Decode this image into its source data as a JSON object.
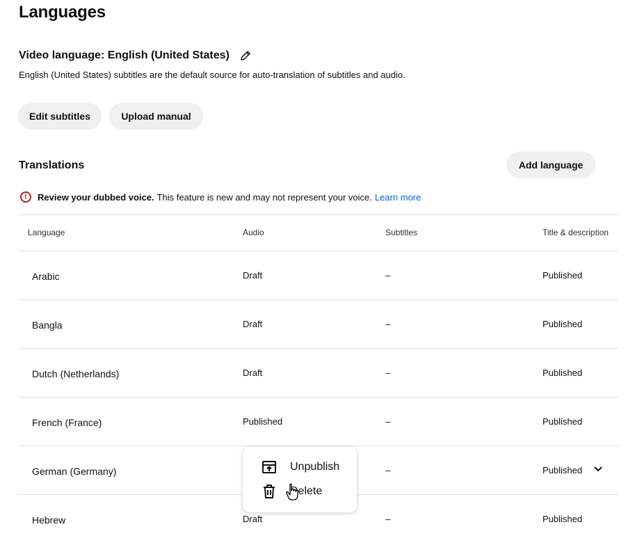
{
  "page": {
    "title": "Languages",
    "video_language_label": "Video language: English (United States)",
    "description": "English (United States) subtitles are the default source for auto-translation of subtitles and audio."
  },
  "buttons": {
    "edit_subtitles": "Edit subtitles",
    "upload_manual": "Upload manual",
    "add_language": "Add language"
  },
  "translations": {
    "heading": "Translations",
    "notice_bold": "Review your dubbed voice.",
    "notice_text": "This feature is new and may not represent your voice.",
    "notice_link": "Learn more"
  },
  "table": {
    "headers": {
      "language": "Language",
      "audio": "Audio",
      "subtitles": "Subtitles",
      "title_desc": "Title & description"
    },
    "rows": [
      {
        "language": "Arabic",
        "audio": "Draft",
        "subtitles": "–",
        "title_desc": "Published"
      },
      {
        "language": "Bangla",
        "audio": "Draft",
        "subtitles": "–",
        "title_desc": "Published"
      },
      {
        "language": "Dutch (Netherlands)",
        "audio": "Draft",
        "subtitles": "–",
        "title_desc": "Published"
      },
      {
        "language": "French (France)",
        "audio": "Published",
        "subtitles": "–",
        "title_desc": "Published"
      },
      {
        "language": "German (Germany)",
        "audio": "",
        "subtitles": "–",
        "title_desc": "Published"
      },
      {
        "language": "Hebrew",
        "audio": "Draft",
        "subtitles": "–",
        "title_desc": "Published"
      }
    ]
  },
  "context_menu": {
    "items": [
      {
        "label": "Unpublish",
        "icon": "unpublish-icon"
      },
      {
        "label": "Delete",
        "icon": "trash-icon"
      }
    ]
  },
  "colors": {
    "warning": "#b3261e",
    "link": "#065fd4",
    "pill_bg": "#f0f0f0",
    "divider": "#e0e0e0"
  }
}
